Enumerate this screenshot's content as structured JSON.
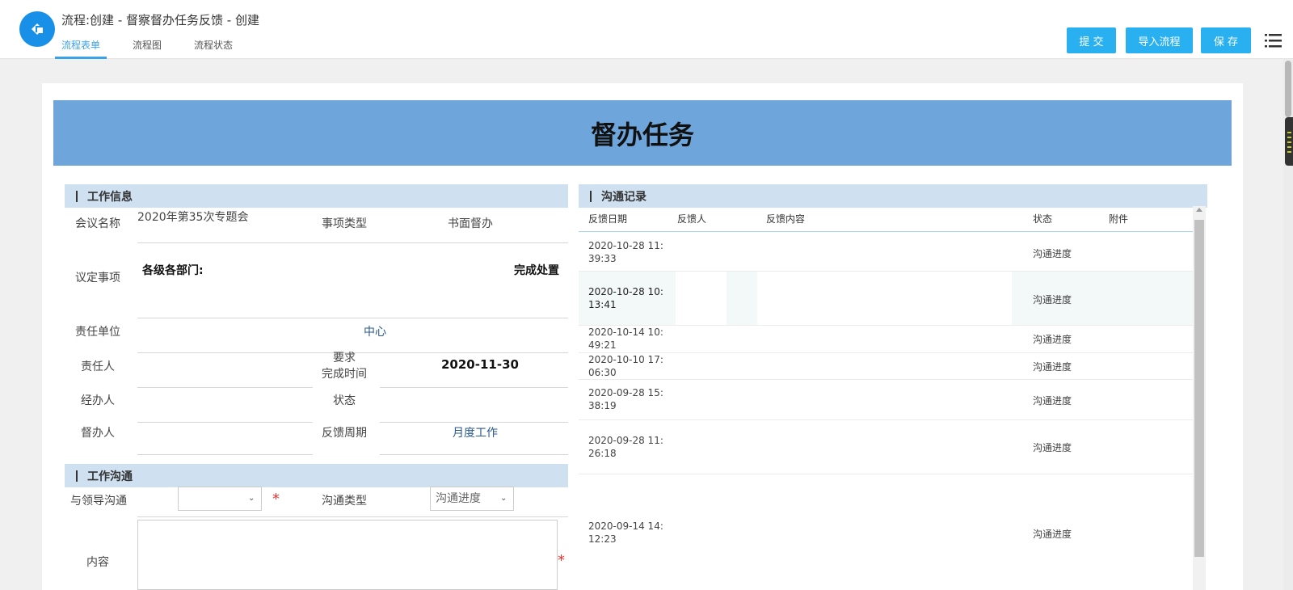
{
  "header": {
    "title": "流程:创建 - 督察督办任务反馈 - 创建",
    "tabs": [
      {
        "label": "流程表单",
        "active": true
      },
      {
        "label": "流程图",
        "active": false
      },
      {
        "label": "流程状态",
        "active": false
      }
    ],
    "buttons": {
      "submit": "提 交",
      "import": "导入流程",
      "save": "保 存"
    }
  },
  "form": {
    "banner_title": "督办任务",
    "work_info": {
      "section_title": "工作信息",
      "meeting_name_label": "会议名称",
      "meeting_name_value": "2020年第35次专题会",
      "item_type_label": "事项类型",
      "item_type_value": "书面督办",
      "agreed_matters_label": "议定事项",
      "agreed_matters_value_left": "各级各部门:",
      "agreed_matters_value_right": "完成处置",
      "resp_unit_label": "责任单位",
      "resp_unit_value": "中心",
      "resp_person_label": "责任人",
      "deadline_label_1": "要求",
      "deadline_label_2": "完成时间",
      "deadline_value": "2020-11-30",
      "handler_label": "经办人",
      "status_label": "状态",
      "supervisor_label": "督办人",
      "feedback_cycle_label": "反馈周期",
      "feedback_cycle_value": "月度工作"
    },
    "work_comm": {
      "section_title": "工作沟通",
      "leader_comm_label": "与领导沟通",
      "leader_comm_value": "",
      "comm_type_label": "沟通类型",
      "comm_type_value": "沟通进度",
      "content_label": "内容",
      "required_mark": "*"
    }
  },
  "comm_records": {
    "section_title": "沟通记录",
    "columns": [
      "反馈日期",
      "反馈人",
      "反馈内容",
      "状态",
      "附件"
    ],
    "rows": [
      {
        "date_line1": "2020-10-28 11:",
        "date_line2": "39:33",
        "status": "沟通进度"
      },
      {
        "date_line1": "2020-10-28 10:",
        "date_line2": "13:41",
        "status": "沟通进度"
      },
      {
        "date_line1": "2020-10-14 10:",
        "date_line2": "49:21",
        "status": "沟通进度"
      },
      {
        "date_line1": "2020-10-10 17:",
        "date_line2": "06:30",
        "status": "沟通进度"
      },
      {
        "date_line1": "2020-09-28 15:",
        "date_line2": "38:19",
        "status": "沟通进度"
      },
      {
        "date_line1": "2020-09-28 11:",
        "date_line2": "26:18",
        "status": "沟通进度"
      },
      {
        "date_line1": "2020-09-14 14:",
        "date_line2": "12:23",
        "status": "沟通进度"
      }
    ]
  },
  "colors": {
    "accent": "#29b0f0",
    "banner": "#6ea5da",
    "section_bg": "#cfe1f1",
    "required": "#e33333"
  },
  "icons": [
    "app-logo-icon",
    "menu-list-icon",
    "chevron-down-icon"
  ]
}
